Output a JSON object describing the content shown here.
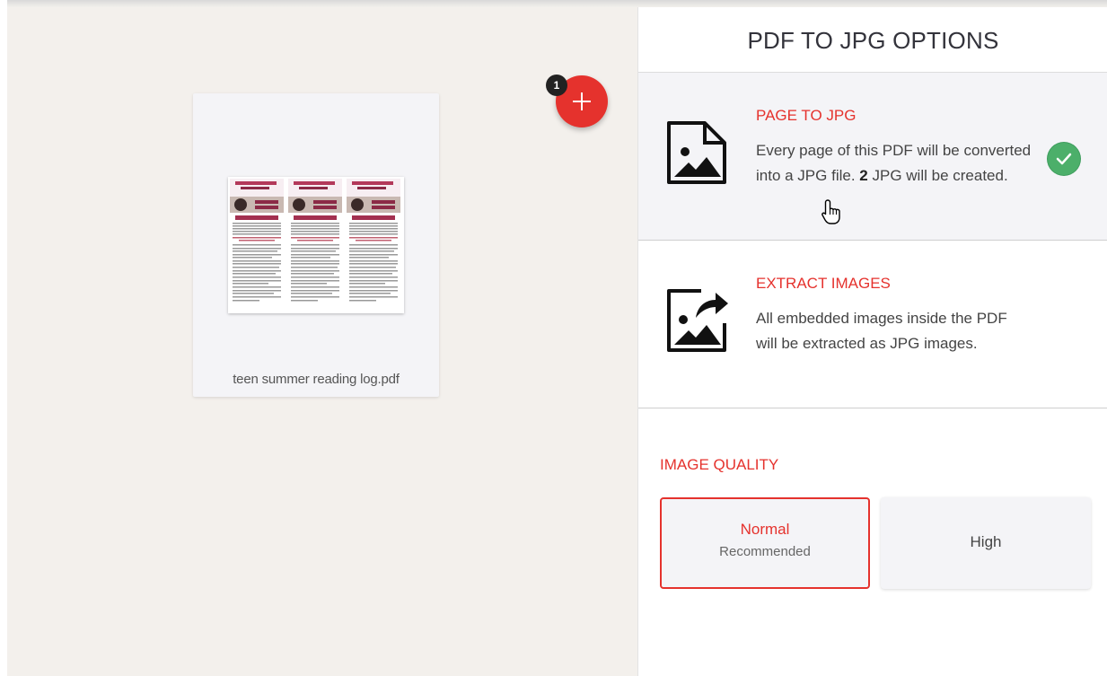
{
  "sidebar": {
    "title": "PDF TO JPG OPTIONS",
    "options": [
      {
        "title": "PAGE TO JPG",
        "desc_before": "Every page of this PDF will be converted into a JPG file.",
        "count": "2",
        "desc_after": "JPG will be created.",
        "selected": true,
        "icon": "image-page-icon"
      },
      {
        "title": "EXTRACT IMAGES",
        "desc": "All embedded images inside the PDF will be extracted as JPG images.",
        "selected": false,
        "icon": "image-extract-icon"
      }
    ],
    "quality": {
      "label": "IMAGE QUALITY",
      "normal_label": "Normal",
      "normal_sub": "Recommended",
      "high_label": "High",
      "selected": "Normal"
    }
  },
  "workspace": {
    "file_name": "teen summer reading log.pdf",
    "file_count_badge": "1"
  },
  "colors": {
    "accent": "#e5322d",
    "check": "#4caf6a",
    "workspace_bg": "#f3f0ec",
    "selected_option_bg": "#f4f4f7"
  }
}
